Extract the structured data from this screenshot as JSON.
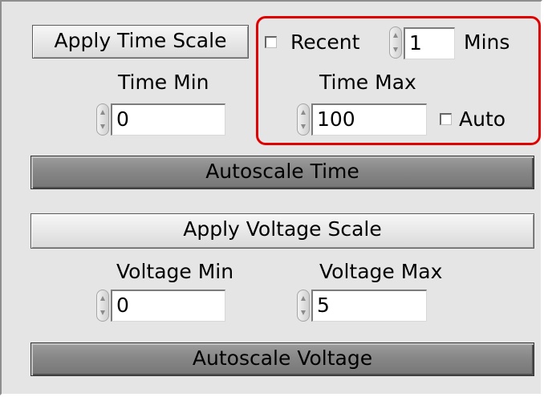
{
  "time_scale": {
    "apply_label": "Apply Time Scale",
    "recent_label": "Recent",
    "recent_value": "1",
    "recent_unit": "Mins",
    "recent_checked": false,
    "min_label": "Time Min",
    "min_value": "0",
    "max_label": "Time Max",
    "max_value": "100",
    "auto_label": "Auto",
    "auto_checked": false,
    "autoscale_label": "Autoscale Time"
  },
  "voltage_scale": {
    "apply_label": "Apply Voltage Scale",
    "min_label": "Voltage Min",
    "min_value": "0",
    "max_label": "Voltage Max",
    "max_value": "5",
    "autoscale_label": "Autoscale Voltage"
  },
  "highlight_color": "#e10000"
}
